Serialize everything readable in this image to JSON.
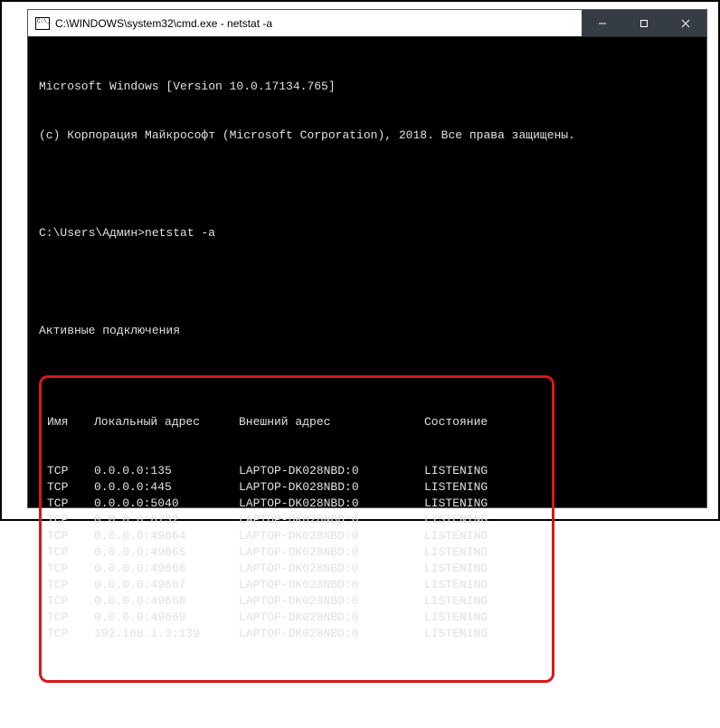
{
  "window": {
    "title": "C:\\WINDOWS\\system32\\cmd.exe - netstat  -a"
  },
  "terminal": {
    "banner1": "Microsoft Windows [Version 10.0.17134.765]",
    "banner2": "(c) Корпорация Майкрософт (Microsoft Corporation), 2018. Все права защищены.",
    "prompt_line": "C:\\Users\\Админ>netstat -a",
    "section_title": "Активные подключения"
  },
  "table": {
    "headers": {
      "proto": "Имя",
      "local": "Локальный адрес",
      "remote": "Внешний адрес",
      "state": "Состояние"
    },
    "rows": [
      {
        "proto": "TCP",
        "local": "0.0.0.0:135",
        "remote": "LAPTOP-DK028NBD:0",
        "state": "LISTENING"
      },
      {
        "proto": "TCP",
        "local": "0.0.0.0:445",
        "remote": "LAPTOP-DK028NBD:0",
        "state": "LISTENING"
      },
      {
        "proto": "TCP",
        "local": "0.0.0.0:5040",
        "remote": "LAPTOP-DK028NBD:0",
        "state": "LISTENING"
      },
      {
        "proto": "TCP",
        "local": "0.0.0.0:8732",
        "remote": "LAPTOP-DK028NBD:0",
        "state": "LISTENING"
      },
      {
        "proto": "TCP",
        "local": "0.0.0.0:49664",
        "remote": "LAPTOP-DK028NBD:0",
        "state": "LISTENING"
      },
      {
        "proto": "TCP",
        "local": "0.0.0.0:49665",
        "remote": "LAPTOP-DK028NBD:0",
        "state": "LISTENING"
      },
      {
        "proto": "TCP",
        "local": "0.0.0.0:49666",
        "remote": "LAPTOP-DK028NBD:0",
        "state": "LISTENING"
      },
      {
        "proto": "TCP",
        "local": "0.0.0.0:49667",
        "remote": "LAPTOP-DK028NBD:0",
        "state": "LISTENING"
      },
      {
        "proto": "TCP",
        "local": "0.0.0.0:49668",
        "remote": "LAPTOP-DK028NBD:0",
        "state": "LISTENING"
      },
      {
        "proto": "TCP",
        "local": "0.0.0.0:49669",
        "remote": "LAPTOP-DK028NBD:0",
        "state": "LISTENING"
      },
      {
        "proto": "TCP",
        "local": "192.168.1.3:139",
        "remote": "LAPTOP-DK028NBD:0",
        "state": "LISTENING"
      }
    ]
  }
}
